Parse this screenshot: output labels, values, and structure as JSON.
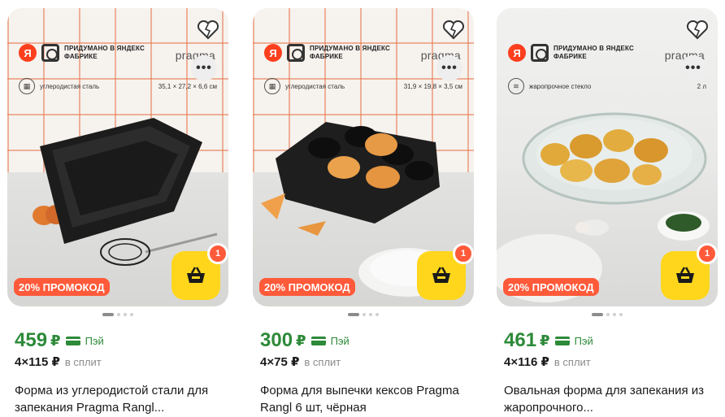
{
  "products": [
    {
      "brand_line": "ПРИДУМАНО В ЯНДЕКС ФАБРИКЕ",
      "ya_logo": "Я",
      "brand": "pragma",
      "material": "углеродистая сталь",
      "dimensions": "35,1 × 27,2 × 6,6 см",
      "promo": "20% ПРОМОКОД",
      "cart_badge": "1",
      "price": "459",
      "currency": "₽",
      "pay_label": "Пэй",
      "split_amount": "4×115 ₽",
      "split_label": "в сплит",
      "title": "Форма из углеродистой стали для запекания Pragma Rangl..."
    },
    {
      "brand_line": "ПРИДУМАНО В ЯНДЕКС ФАБРИКЕ",
      "ya_logo": "Я",
      "brand": "pragma",
      "material": "углеродистая сталь",
      "dimensions": "31,9 × 19,8 × 3,5 см",
      "promo": "20% ПРОМОКОД",
      "cart_badge": "1",
      "price": "300",
      "currency": "₽",
      "pay_label": "Пэй",
      "split_amount": "4×75 ₽",
      "split_label": "в сплит",
      "title": "Форма для выпечки кексов Pragma Rangl 6 шт, чёрная"
    },
    {
      "brand_line": "ПРИДУМАНО В ЯНДЕКС ФАБРИКЕ",
      "ya_logo": "Я",
      "brand": "pragma",
      "material": "жаропрочное стекло",
      "dimensions": "2 л",
      "promo": "20% ПРОМОКОД",
      "cart_badge": "1",
      "price": "461",
      "currency": "₽",
      "pay_label": "Пэй",
      "split_amount": "4×116 ₽",
      "split_label": "в сплит",
      "title": "Овальная форма для запекания из жаропрочного..."
    }
  ],
  "colors": {
    "price_green": "#2d8a39",
    "promo_red": "#ff5a3a",
    "cart_yellow": "#ffd61c",
    "yandex_red": "#fc3f1d"
  },
  "icons": [
    "heart-broken-icon",
    "more-dots-icon",
    "cart-basket-icon",
    "pay-card-icon"
  ]
}
